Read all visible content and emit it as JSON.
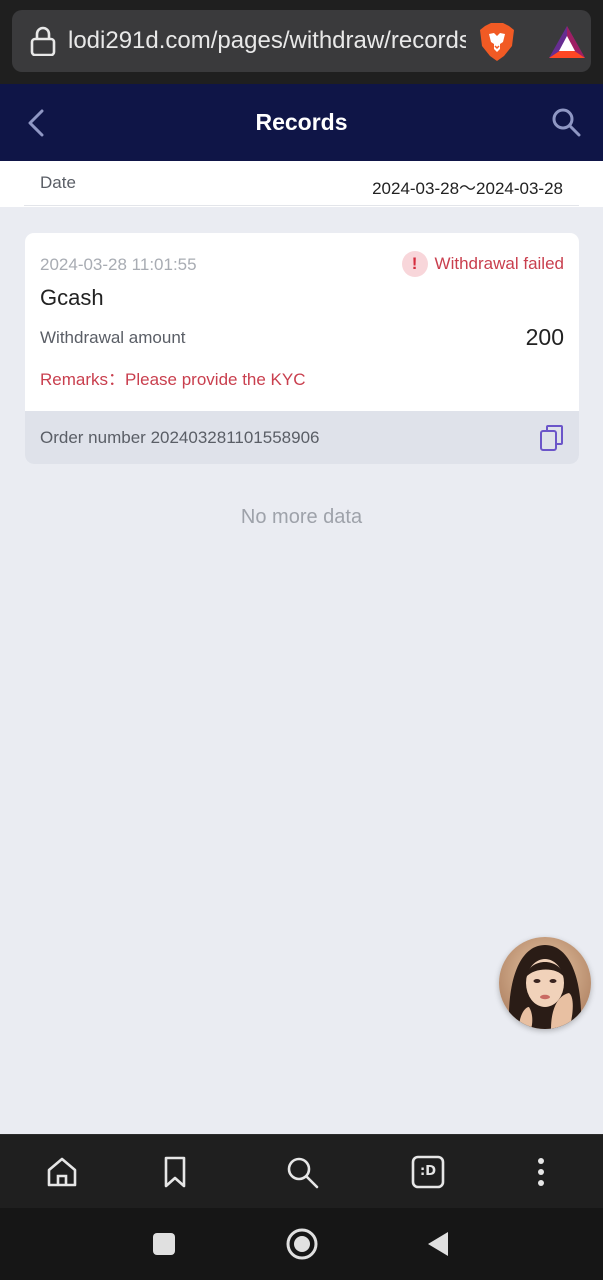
{
  "browser": {
    "url": "lodi291d.com/pages/withdraw/records",
    "lock_icon": "lock-icon",
    "shield_icon": "brave-lion-icon",
    "rewards_icon": "bat-triangle-icon"
  },
  "header": {
    "title": "Records",
    "back_icon": "chevron-left-icon",
    "search_icon": "search-icon"
  },
  "filter": {
    "date_label": "Date",
    "date_range": "2024-03-28～2024-03-28"
  },
  "records": [
    {
      "time": "2024-03-28 11:01:55",
      "status": "Withdrawal failed",
      "method": "Gcash",
      "amount_label": "Withdrawal amount",
      "amount": "200",
      "remarks_label": "Remarks：",
      "remarks_text": "Please provide the KYC",
      "order_label": "Order number",
      "order_number": "202403281101558906"
    }
  ],
  "list": {
    "no_more": "No more data"
  },
  "colors": {
    "header_bg": "#0f1547",
    "page_bg": "#eaecf2",
    "error_red": "#c93f4e",
    "copy_icon": "#6b55c9"
  },
  "bottom_toolbar": [
    "home-icon",
    "bookmark-icon",
    "search-icon",
    "tabs-icon",
    "more-vertical-icon"
  ],
  "tabs_badge": ":D",
  "android_nav": [
    "recents-square-icon",
    "home-circle-icon",
    "back-triangle-icon"
  ]
}
